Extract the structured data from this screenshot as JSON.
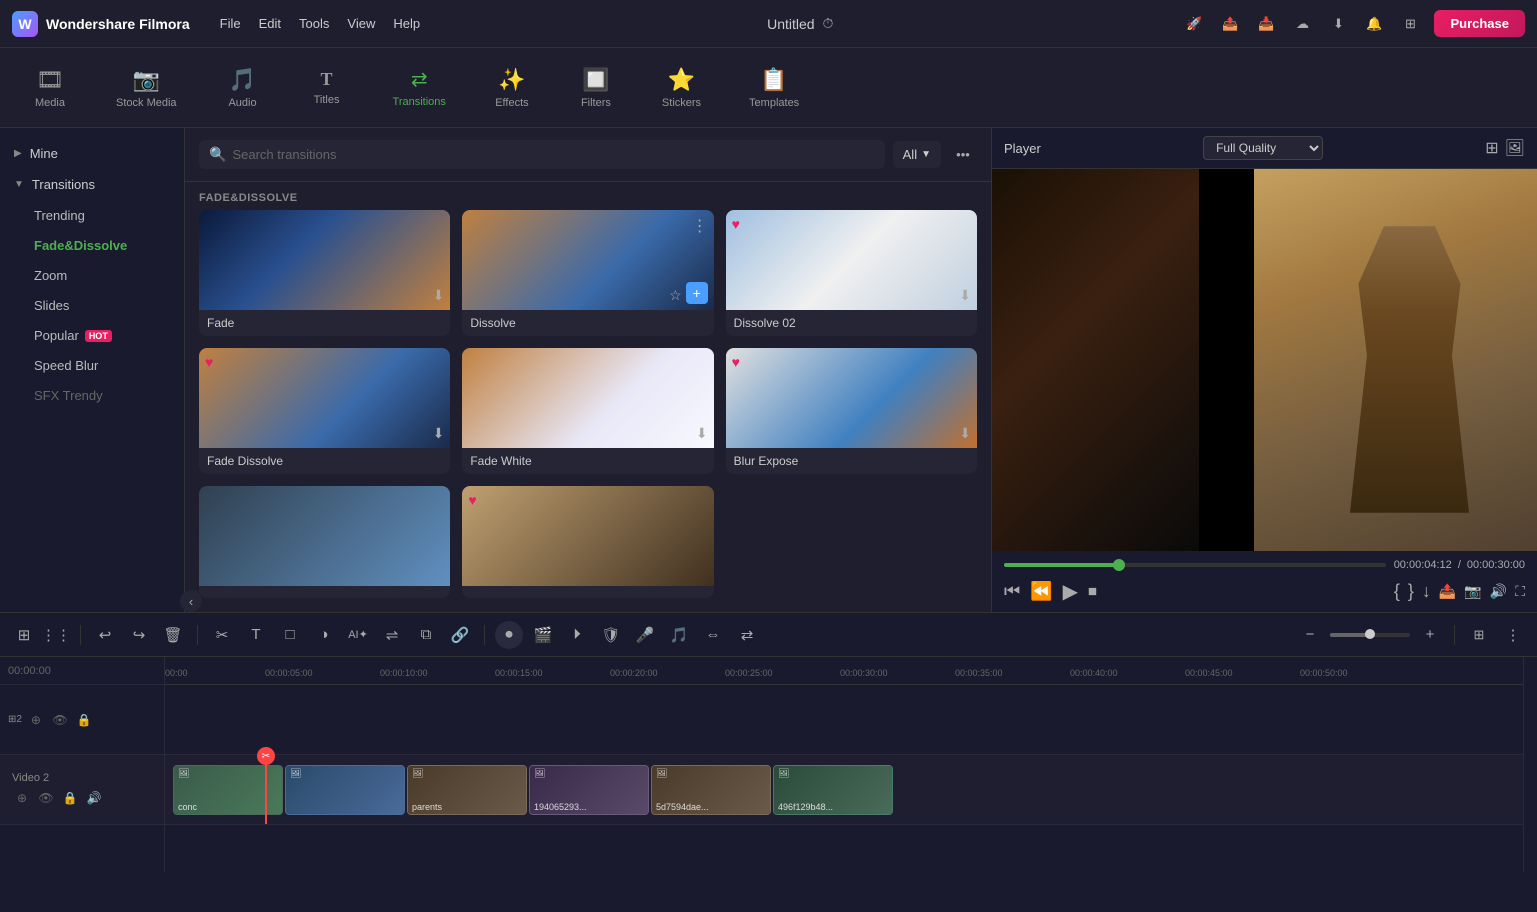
{
  "app": {
    "name": "Wondershare Filmora",
    "title": "Untitled",
    "purchase_label": "Purchase"
  },
  "topbar_menu": {
    "file": "File",
    "edit": "Edit",
    "tools": "Tools",
    "view": "View",
    "help": "Help"
  },
  "nav_tabs": [
    {
      "id": "media",
      "icon": "🎞",
      "label": "Media"
    },
    {
      "id": "stock-media",
      "icon": "📷",
      "label": "Stock Media"
    },
    {
      "id": "audio",
      "icon": "🎵",
      "label": "Audio"
    },
    {
      "id": "titles",
      "icon": "T",
      "label": "Titles"
    },
    {
      "id": "transitions",
      "icon": "▶",
      "label": "Transitions",
      "active": true
    },
    {
      "id": "effects",
      "icon": "✨",
      "label": "Effects"
    },
    {
      "id": "filters",
      "icon": "🔲",
      "label": "Filters"
    },
    {
      "id": "stickers",
      "icon": "⭐",
      "label": "Stickers"
    },
    {
      "id": "templates",
      "icon": "📋",
      "label": "Templates"
    }
  ],
  "sidebar": {
    "mine_label": "Mine",
    "transitions_label": "Transitions",
    "items": [
      {
        "id": "trending",
        "label": "Trending",
        "active": false
      },
      {
        "id": "fade-dissolve",
        "label": "Fade&Dissolve",
        "active": true
      },
      {
        "id": "zoom",
        "label": "Zoom",
        "active": false
      },
      {
        "id": "slides",
        "label": "Slides",
        "active": false
      },
      {
        "id": "popular",
        "label": "Popular",
        "active": false,
        "badge": "HOT"
      },
      {
        "id": "speed-blur",
        "label": "Speed Blur",
        "active": false
      },
      {
        "id": "sfx-trendy",
        "label": "SFX Trendy",
        "active": false
      }
    ]
  },
  "transitions_panel": {
    "search_placeholder": "Search transitions",
    "filter_label": "All",
    "section_title": "FADE&DISSOLVE",
    "cards": [
      {
        "id": "fade",
        "label": "Fade",
        "thumb_class": "thumb-skydive-1",
        "has_heart": false,
        "has_download": true
      },
      {
        "id": "dissolve",
        "label": "Dissolve",
        "thumb_class": "thumb-skydive-2",
        "has_heart": false,
        "has_download": false,
        "has_star": true,
        "has_add": true,
        "has_more": true
      },
      {
        "id": "dissolve-02",
        "label": "Dissolve 02",
        "thumb_class": "thumb-skydive-blur",
        "has_heart": true,
        "has_download": true
      },
      {
        "id": "fade-dissolve",
        "label": "Fade Dissolve",
        "thumb_class": "thumb-skydive-2",
        "has_heart": true,
        "has_download": true
      },
      {
        "id": "fade-white",
        "label": "Fade White",
        "thumb_class": "thumb-skydive-fade",
        "has_heart": false,
        "has_download": true
      },
      {
        "id": "blur-expose",
        "label": "Blur Expose",
        "thumb_class": "thumb-expose",
        "has_heart": true,
        "has_download": true
      },
      {
        "id": "bottom1",
        "label": "",
        "thumb_class": "thumb-bottom1",
        "has_heart": false,
        "has_download": false
      },
      {
        "id": "bottom2",
        "label": "",
        "thumb_class": "thumb-bottom2",
        "has_heart": true,
        "has_download": false
      }
    ]
  },
  "player": {
    "label": "Player",
    "quality": "Full Quality",
    "time_current": "00:00:04:12",
    "time_total": "00:00:30:00",
    "time_separator": "/"
  },
  "timeline": {
    "video2_label": "Video 2",
    "ruler_marks": [
      "00:00",
      "00:05:00",
      "00:10:00",
      "00:15:00",
      "00:20:00",
      "00:25:00",
      "00:30:00",
      "00:35:00",
      "00:40:00",
      "00:45:00",
      "00:50:00"
    ],
    "clips": [
      {
        "id": "conc",
        "label": "conc",
        "icon": "🖼"
      },
      {
        "id": "parents",
        "label": "parents",
        "icon": "🖼"
      },
      {
        "id": "clip3",
        "label": "194065293...",
        "icon": "🖼"
      },
      {
        "id": "clip4",
        "label": "5d7594dae...",
        "icon": "🖼"
      },
      {
        "id": "clip5",
        "label": "496f129b48...",
        "icon": "🖼"
      }
    ]
  },
  "toolbar": {
    "undo_label": "Undo",
    "redo_label": "Redo"
  }
}
